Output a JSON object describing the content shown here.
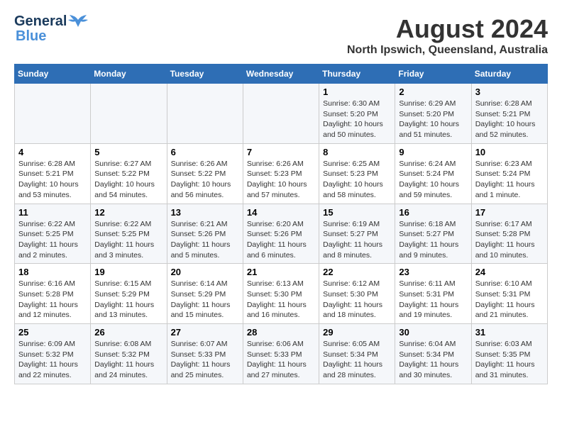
{
  "logo": {
    "line1": "General",
    "line2": "Blue"
  },
  "title": "August 2024",
  "subtitle": "North Ipswich, Queensland, Australia",
  "days_of_week": [
    "Sunday",
    "Monday",
    "Tuesday",
    "Wednesday",
    "Thursday",
    "Friday",
    "Saturday"
  ],
  "weeks": [
    [
      {
        "day": "",
        "info": ""
      },
      {
        "day": "",
        "info": ""
      },
      {
        "day": "",
        "info": ""
      },
      {
        "day": "",
        "info": ""
      },
      {
        "day": "1",
        "info": "Sunrise: 6:30 AM\nSunset: 5:20 PM\nDaylight: 10 hours and 50 minutes."
      },
      {
        "day": "2",
        "info": "Sunrise: 6:29 AM\nSunset: 5:20 PM\nDaylight: 10 hours and 51 minutes."
      },
      {
        "day": "3",
        "info": "Sunrise: 6:28 AM\nSunset: 5:21 PM\nDaylight: 10 hours and 52 minutes."
      }
    ],
    [
      {
        "day": "4",
        "info": "Sunrise: 6:28 AM\nSunset: 5:21 PM\nDaylight: 10 hours and 53 minutes."
      },
      {
        "day": "5",
        "info": "Sunrise: 6:27 AM\nSunset: 5:22 PM\nDaylight: 10 hours and 54 minutes."
      },
      {
        "day": "6",
        "info": "Sunrise: 6:26 AM\nSunset: 5:22 PM\nDaylight: 10 hours and 56 minutes."
      },
      {
        "day": "7",
        "info": "Sunrise: 6:26 AM\nSunset: 5:23 PM\nDaylight: 10 hours and 57 minutes."
      },
      {
        "day": "8",
        "info": "Sunrise: 6:25 AM\nSunset: 5:23 PM\nDaylight: 10 hours and 58 minutes."
      },
      {
        "day": "9",
        "info": "Sunrise: 6:24 AM\nSunset: 5:24 PM\nDaylight: 10 hours and 59 minutes."
      },
      {
        "day": "10",
        "info": "Sunrise: 6:23 AM\nSunset: 5:24 PM\nDaylight: 11 hours and 1 minute."
      }
    ],
    [
      {
        "day": "11",
        "info": "Sunrise: 6:22 AM\nSunset: 5:25 PM\nDaylight: 11 hours and 2 minutes."
      },
      {
        "day": "12",
        "info": "Sunrise: 6:22 AM\nSunset: 5:25 PM\nDaylight: 11 hours and 3 minutes."
      },
      {
        "day": "13",
        "info": "Sunrise: 6:21 AM\nSunset: 5:26 PM\nDaylight: 11 hours and 5 minutes."
      },
      {
        "day": "14",
        "info": "Sunrise: 6:20 AM\nSunset: 5:26 PM\nDaylight: 11 hours and 6 minutes."
      },
      {
        "day": "15",
        "info": "Sunrise: 6:19 AM\nSunset: 5:27 PM\nDaylight: 11 hours and 8 minutes."
      },
      {
        "day": "16",
        "info": "Sunrise: 6:18 AM\nSunset: 5:27 PM\nDaylight: 11 hours and 9 minutes."
      },
      {
        "day": "17",
        "info": "Sunrise: 6:17 AM\nSunset: 5:28 PM\nDaylight: 11 hours and 10 minutes."
      }
    ],
    [
      {
        "day": "18",
        "info": "Sunrise: 6:16 AM\nSunset: 5:28 PM\nDaylight: 11 hours and 12 minutes."
      },
      {
        "day": "19",
        "info": "Sunrise: 6:15 AM\nSunset: 5:29 PM\nDaylight: 11 hours and 13 minutes."
      },
      {
        "day": "20",
        "info": "Sunrise: 6:14 AM\nSunset: 5:29 PM\nDaylight: 11 hours and 15 minutes."
      },
      {
        "day": "21",
        "info": "Sunrise: 6:13 AM\nSunset: 5:30 PM\nDaylight: 11 hours and 16 minutes."
      },
      {
        "day": "22",
        "info": "Sunrise: 6:12 AM\nSunset: 5:30 PM\nDaylight: 11 hours and 18 minutes."
      },
      {
        "day": "23",
        "info": "Sunrise: 6:11 AM\nSunset: 5:31 PM\nDaylight: 11 hours and 19 minutes."
      },
      {
        "day": "24",
        "info": "Sunrise: 6:10 AM\nSunset: 5:31 PM\nDaylight: 11 hours and 21 minutes."
      }
    ],
    [
      {
        "day": "25",
        "info": "Sunrise: 6:09 AM\nSunset: 5:32 PM\nDaylight: 11 hours and 22 minutes."
      },
      {
        "day": "26",
        "info": "Sunrise: 6:08 AM\nSunset: 5:32 PM\nDaylight: 11 hours and 24 minutes."
      },
      {
        "day": "27",
        "info": "Sunrise: 6:07 AM\nSunset: 5:33 PM\nDaylight: 11 hours and 25 minutes."
      },
      {
        "day": "28",
        "info": "Sunrise: 6:06 AM\nSunset: 5:33 PM\nDaylight: 11 hours and 27 minutes."
      },
      {
        "day": "29",
        "info": "Sunrise: 6:05 AM\nSunset: 5:34 PM\nDaylight: 11 hours and 28 minutes."
      },
      {
        "day": "30",
        "info": "Sunrise: 6:04 AM\nSunset: 5:34 PM\nDaylight: 11 hours and 30 minutes."
      },
      {
        "day": "31",
        "info": "Sunrise: 6:03 AM\nSunset: 5:35 PM\nDaylight: 11 hours and 31 minutes."
      }
    ]
  ]
}
